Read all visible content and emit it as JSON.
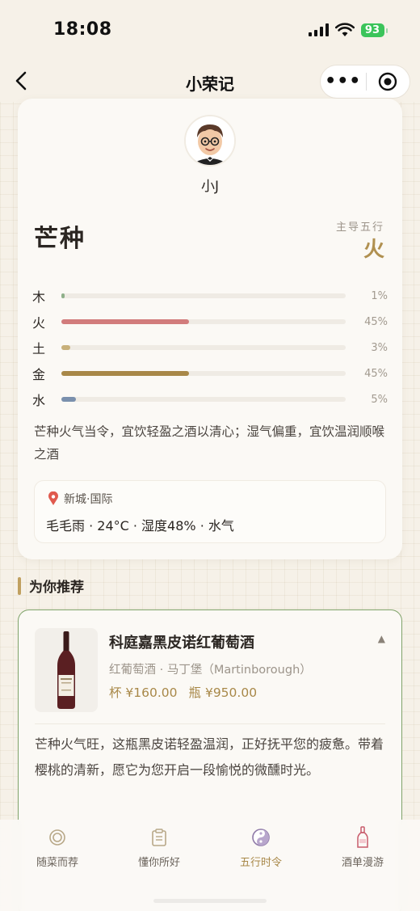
{
  "status_bar": {
    "time": "18:08",
    "battery": "93"
  },
  "nav": {
    "title": "小荣记",
    "more_label": "•••"
  },
  "profile": {
    "name": "小J"
  },
  "solar_term": {
    "name": "芒种",
    "dominant_label": "主导五行",
    "dominant_value": "火"
  },
  "elements": [
    {
      "name": "木",
      "percent_label": "1%",
      "percent": 1,
      "color": "#8fb08a"
    },
    {
      "name": "火",
      "percent_label": "45%",
      "percent": 45,
      "color": "#d27c7c"
    },
    {
      "name": "土",
      "percent_label": "3%",
      "percent": 3,
      "color": "#c8b07a"
    },
    {
      "name": "金",
      "percent_label": "45%",
      "percent": 45,
      "color": "#a88848"
    },
    {
      "name": "水",
      "percent_label": "5%",
      "percent": 5,
      "color": "#7a90ad"
    }
  ],
  "advice": "芒种火气当令，宜饮轻盈之酒以清心；湿气偏重，宜饮温润顺喉之酒",
  "weather": {
    "location": "新城·国际",
    "summary": "毛毛雨 · 24°C · 湿度48% · 水气"
  },
  "recommend": {
    "section_title": "为你推荐",
    "wine_name": "科庭嘉黑皮诺红葡萄酒",
    "wine_meta": "红葡萄酒 · 马丁堡（Martinborough）",
    "price_glass": "杯 ¥160.00",
    "price_bottle": "瓶 ¥950.00",
    "collapse_glyph": "▲",
    "description": "芒种火气旺，这瓶黑皮诺轻盈温润，正好抚平您的疲惫。带着樱桃的清新，愿它为您开启一段愉悦的微醺时光。"
  },
  "tabs": [
    {
      "label": "随菜而荐",
      "icon": "dish-icon"
    },
    {
      "label": "懂你所好",
      "icon": "clipboard-icon"
    },
    {
      "label": "五行时令",
      "icon": "yin-yang-icon",
      "active": true
    },
    {
      "label": "酒单漫游",
      "icon": "wine-bottle-icon"
    }
  ],
  "colors": {
    "accent": "#a88848",
    "card_border": "#7fa36a",
    "battery": "#3bc45a"
  }
}
